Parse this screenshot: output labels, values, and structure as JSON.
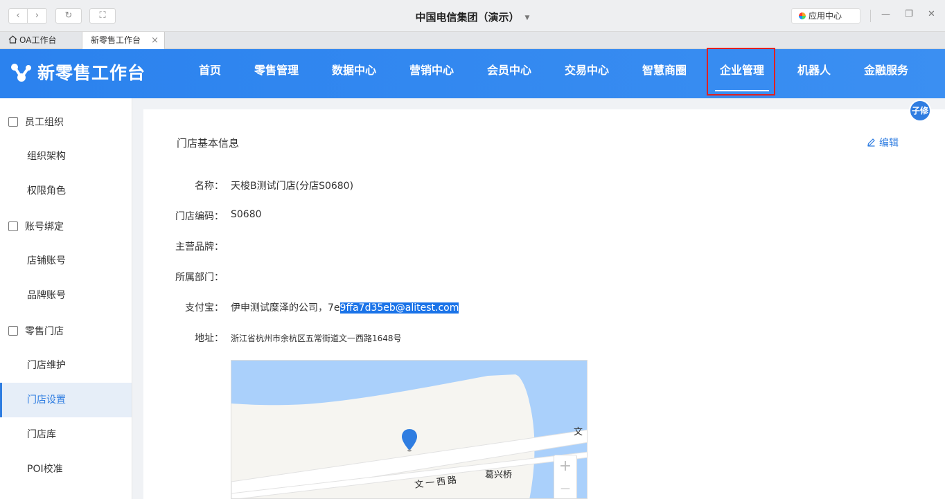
{
  "window": {
    "title": "中国电信集团（演示）",
    "app_center": "应用中心",
    "minimize": "—",
    "restore": "❐",
    "close": "✕"
  },
  "tabs": [
    {
      "label": "OA工作台",
      "icon": "home-icon"
    },
    {
      "label": "新零售工作台",
      "close": "×"
    }
  ],
  "header": {
    "logo_text": "新零售工作台",
    "nav": [
      "首页",
      "零售管理",
      "数据中心",
      "营销中心",
      "会员中心",
      "交易中心",
      "智慧商圈",
      "企业管理",
      "机器人",
      "金融服务"
    ],
    "active_nav": "企业管理"
  },
  "sidebar": {
    "groups": [
      {
        "label": "员工组织",
        "icon": "org-icon",
        "items": [
          "组织架构",
          "权限角色"
        ]
      },
      {
        "label": "账号绑定",
        "icon": "account-icon",
        "items": [
          "店铺账号",
          "品牌账号"
        ]
      },
      {
        "label": "零售门店",
        "icon": "store-icon",
        "items": [
          "门店维护",
          "门店设置",
          "门店库",
          "POI校准"
        ]
      }
    ],
    "active_item": "门店设置"
  },
  "main": {
    "section_title": "门店基本信息",
    "edit_label": "编辑",
    "avatar_text": "子修",
    "fields": [
      {
        "label": "名称：",
        "value": "天梭B测试门店(分店S0680)"
      },
      {
        "label": "门店编码：",
        "value": "S0680"
      },
      {
        "label": "主营品牌：",
        "value": ""
      },
      {
        "label": "所属部门：",
        "value": ""
      },
      {
        "label": "支付宝：",
        "value_prefix": "伊申测试糜泽的公司，7e",
        "value_highlight": "9ffa7d35eb@alitest.com"
      },
      {
        "label": "地址：",
        "value": "浙江省杭州市余杭区五常街道文一西路1648号"
      }
    ],
    "map": {
      "road_label": "文一西路",
      "place_label": "葛兴桥",
      "edge_label": "文",
      "zoom_in": "+",
      "zoom_out": "—"
    }
  },
  "colors": {
    "header_blue": "#2b82ee",
    "accent": "#2f7de1",
    "annotation_red": "#e02020"
  }
}
